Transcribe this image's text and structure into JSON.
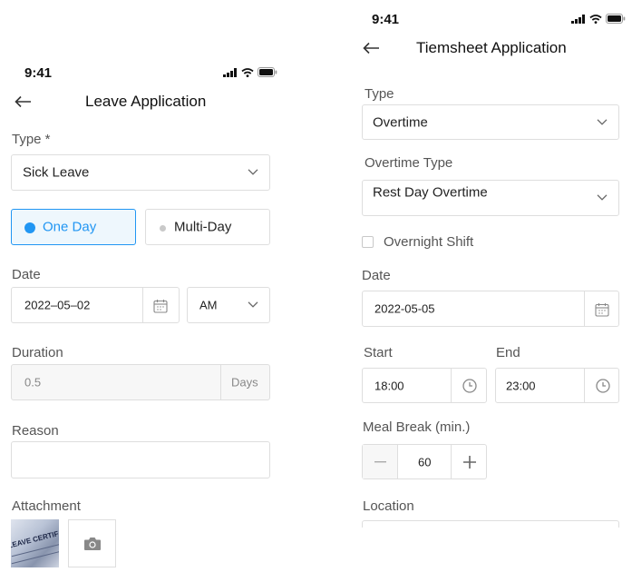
{
  "status": {
    "time": "9:41"
  },
  "leave": {
    "title": "Leave Application",
    "type_label": "Type *",
    "type_value": "Sick Leave",
    "one_day": "One Day",
    "multi_day": "Multi-Day",
    "date_label": "Date",
    "date_value": "2022–05–02",
    "period_value": "AM",
    "duration_label": "Duration",
    "duration_value": "0.5",
    "duration_unit": "Days",
    "reason_label": "Reason",
    "reason_value": "",
    "attachment_label": "Attachment",
    "thumb_text": "LEAVE CERTIF"
  },
  "timesheet": {
    "title": "Tiemsheet Application",
    "type_label": "Type",
    "type_value": "Overtime",
    "ot_type_label": "Overtime Type",
    "ot_type_value": "Rest Day Overtime",
    "overnight_label": "Overnight Shift",
    "overnight_checked": false,
    "date_label": "Date",
    "date_value": "2022-05-05",
    "start_label": "Start",
    "start_value": "18:00",
    "end_label": "End",
    "end_value": "23:00",
    "meal_label": "Meal Break (min.)",
    "meal_value": "60",
    "location_label": "Location"
  },
  "colors": {
    "accent": "#2196f3",
    "accent_bg": "#eef7fd",
    "border": "#dedede",
    "disabled_bg": "#f7f7f7"
  },
  "icons": [
    "back-arrow-icon",
    "signal-icon",
    "wifi-icon",
    "battery-icon",
    "chevron-down-icon",
    "calendar-icon",
    "clock-icon",
    "minus-icon",
    "plus-icon",
    "camera-icon"
  ]
}
